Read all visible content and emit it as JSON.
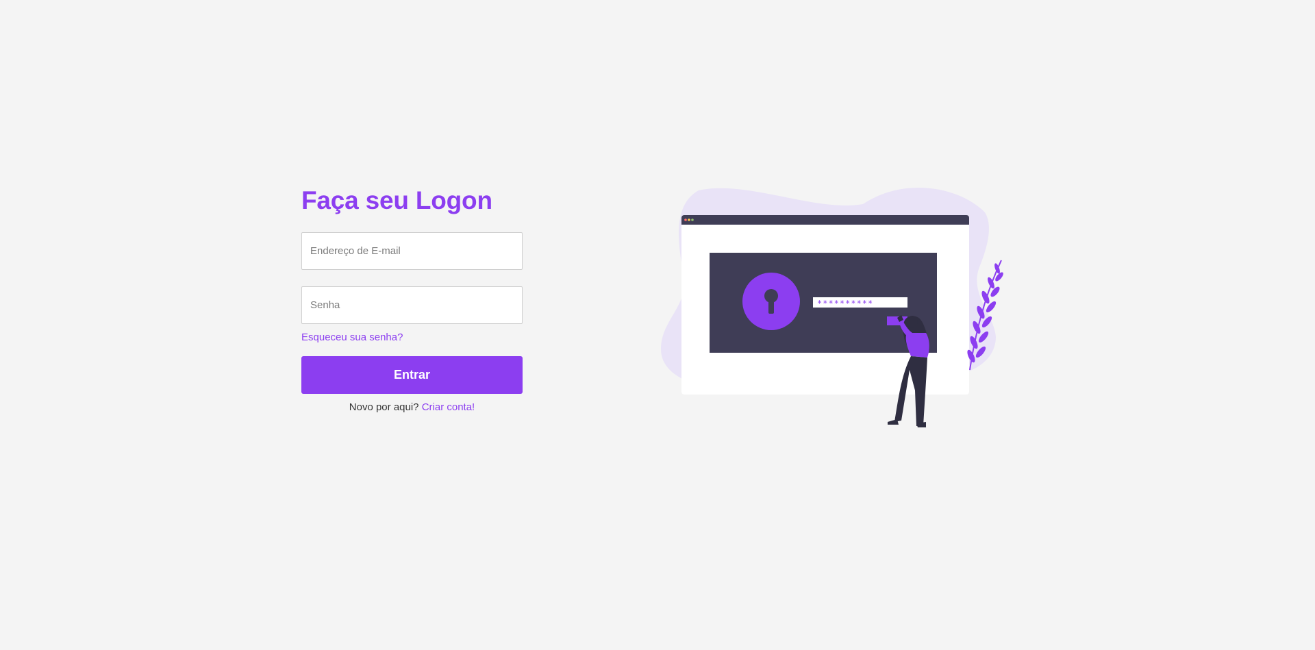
{
  "login": {
    "title": "Faça seu Logon",
    "email_placeholder": "Endereço de E-mail",
    "password_placeholder": "Senha",
    "forgot_link": "Esqueceu sua senha?",
    "submit_label": "Entrar",
    "signup_prompt": "Novo por aqui?",
    "signup_link": "Criar conta!"
  },
  "illustration": {
    "masked_password": "**********"
  },
  "colors": {
    "accent": "#8c3ef0",
    "background": "#f4f4f4",
    "dark_panel": "#3f3d56",
    "blob": "#e9e3f7"
  }
}
